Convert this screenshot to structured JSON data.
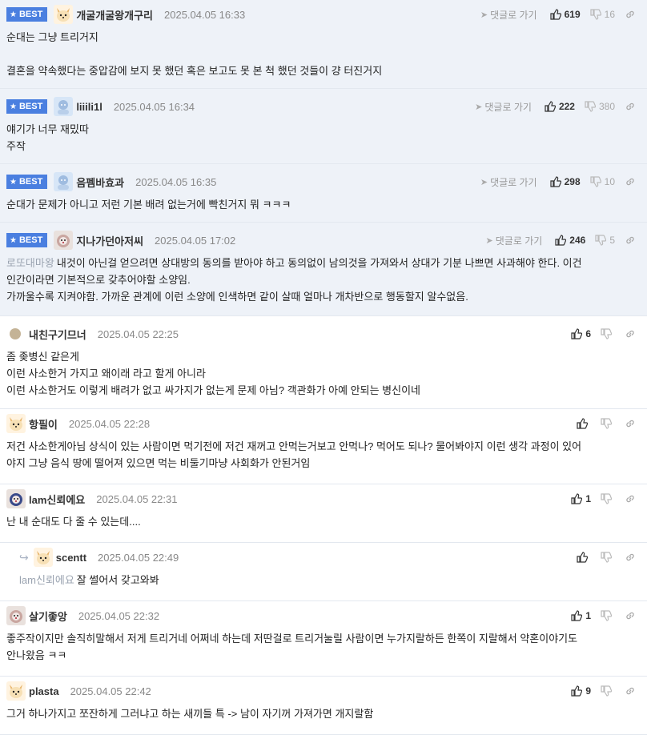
{
  "labels": {
    "best": "BEST",
    "reply_link": "댓글로 가기"
  },
  "comments": [
    {
      "nick": "개굴개굴왕개구리",
      "date": "2025.04.05 16:33",
      "up": "619",
      "down": "16",
      "lines": [
        "순대는 그냥 트리거지",
        "",
        "결혼을 약속했다는 중압감에 보지 못 했던 혹은 보고도 못 본 척 했던 것들이 걍 터진거지"
      ]
    },
    {
      "nick": "liiili1l",
      "date": "2025.04.05 16:34",
      "up": "222",
      "down": "380",
      "lines": [
        "얘기가 너무 재밌따",
        "주작"
      ]
    },
    {
      "nick": "음펨바효과",
      "date": "2025.04.05 16:35",
      "up": "298",
      "down": "10",
      "lines": [
        "순대가 문제가 아니고 저런 기본 배려 없는거에 빡친거지 뭐 ㅋㅋㅋ"
      ]
    },
    {
      "nick": "지나가던아저씨",
      "date": "2025.04.05 17:02",
      "up": "246",
      "down": "5",
      "mention": "로또대마왕",
      "lines": [
        "내것이 아닌걸 얻으려면 상대방의 동의를 받아야 하고 동의없이 남의것을 가져와서 상대가 기분 나쁘면 사과해야 한다. 이건",
        "인간이라면 기본적으로 갖추어야할 소양임.",
        "가까울수록 지켜야함. 가까운 관계에 이런 소양에 인색하면 같이 살때 얼마나 개차반으로 행동할지 알수없음."
      ]
    },
    {
      "nick": "내친구기므너",
      "date": "2025.04.05 22:25",
      "up": "6",
      "lines": [
        "좀 좆병신 같은게",
        "이런 사소한거 가지고 왜이래 라고 할게 아니라",
        "이런 사소한거도 이렇게 배려가 없고 싸가지가 없는게 문제 아님? 객관화가 아예 안되는 병신이네"
      ]
    },
    {
      "nick": "항필이",
      "date": "2025.04.05 22:28",
      "up": "",
      "lines": [
        "저건 사소한게아님 상식이 있는 사람이면 먹기전에 저건 재꺼고 안먹는거보고 안먹나? 먹어도 되나? 물어봐야지 이런 생각 과정이 있어",
        "야지 그냥 음식 땅에 떨어져 있으면 먹는 비둘기마냥 사회화가 안된거임"
      ]
    },
    {
      "nick": "lam신뢰에요",
      "date": "2025.04.05 22:31",
      "up": "1",
      "lines": [
        "난 내 순대도 다 줄 수 있는데...."
      ]
    },
    {
      "nick": "scentt",
      "date": "2025.04.05 22:49",
      "up": "",
      "mention": "lam신뢰에요",
      "lines": [
        "잘 썰어서 갖고와봐"
      ]
    },
    {
      "nick": "살기좋앙",
      "date": "2025.04.05 22:32",
      "up": "1",
      "lines": [
        "좋주작이지만 솔직히말해서 저게 트리거네 어쩌네 하는데 저딴걸로 트리거눌릴 사람이면 누가지랄하든 한쪽이 지랄해서 약혼이야기도",
        "안나왔음 ㅋㅋ"
      ]
    },
    {
      "nick": "plasta",
      "date": "2025.04.05 22:42",
      "up": "9",
      "lines": [
        "그거 하나가지고 쪼잔하게 그러냐고 하는 새끼들 특 -> 남이 자기꺼 가져가면 개지랄함"
      ]
    }
  ],
  "icons": {
    "best_star": "star-icon",
    "reply_arrow": "send-arrow-icon",
    "thumb_up": "thumbs-up-icon",
    "thumb_down": "thumbs-down-icon",
    "link": "link-icon",
    "reply_indicator": "reply-arrow-icon"
  },
  "colors": {
    "best_badge": "#4a7fe0",
    "best_bg": "#eef2f8",
    "mention": "#9aa3b0"
  }
}
